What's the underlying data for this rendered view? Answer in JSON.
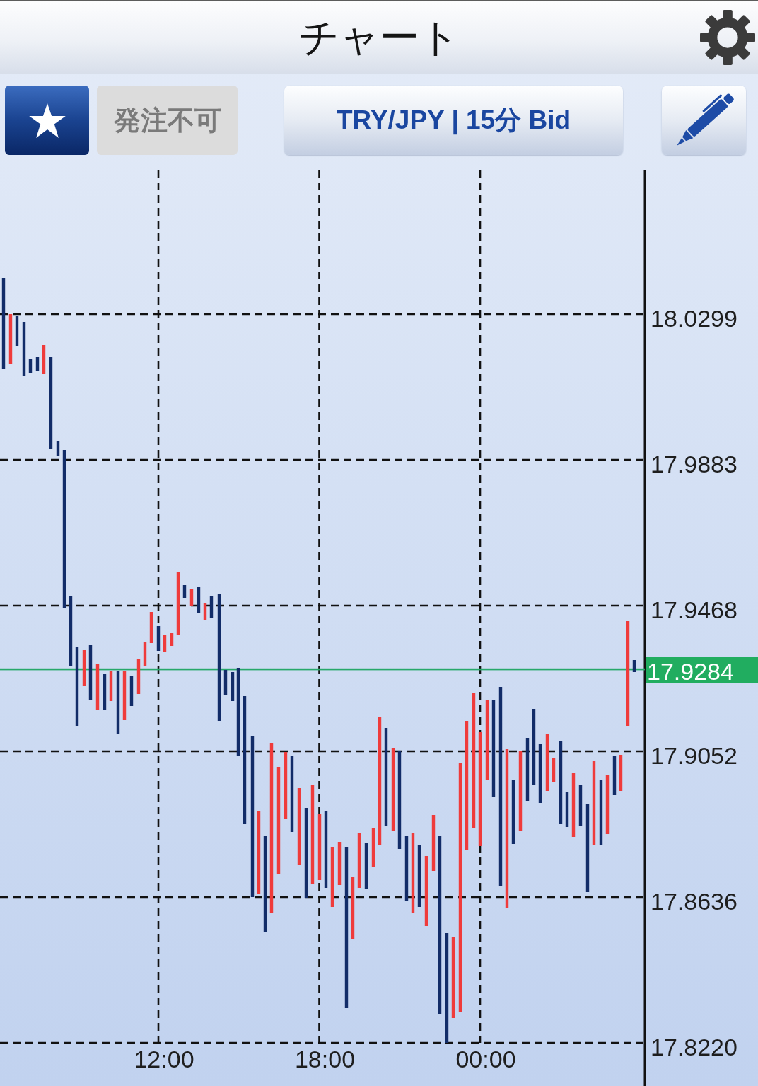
{
  "header": {
    "title": "チャート"
  },
  "toolbar": {
    "order_button": {
      "label": "発注不可",
      "disabled": true
    },
    "symbol_button": {
      "label": "TRY/JPY | 15分 Bid"
    }
  },
  "chart": {
    "price_labels": [
      "18.0299",
      "17.9883",
      "17.9468",
      "17.9052",
      "17.8636",
      "17.8220"
    ],
    "time_labels": [
      "12:00",
      "18:00",
      "00:00"
    ],
    "current_price": "17.9284"
  }
}
